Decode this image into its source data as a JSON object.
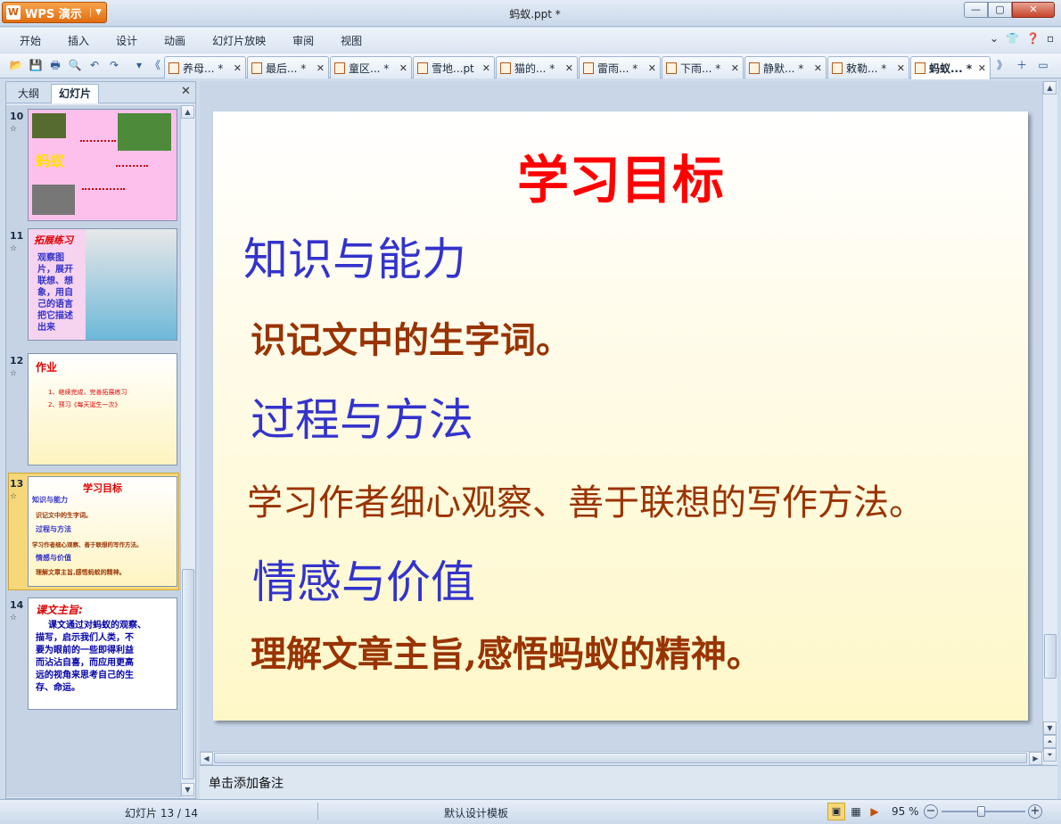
{
  "app": {
    "name": "WPS 演示",
    "doc_title": "蚂蚁.ppt *"
  },
  "window_controls": {
    "min": "—",
    "max": "▢",
    "close": "✕"
  },
  "menu": [
    "开始",
    "插入",
    "设计",
    "动画",
    "幻灯片放映",
    "审阅",
    "视图"
  ],
  "doc_tabs": [
    {
      "label": "养母... *"
    },
    {
      "label": "最后... *"
    },
    {
      "label": "童区... *"
    },
    {
      "label": "雪地...pt"
    },
    {
      "label": "猫的... *"
    },
    {
      "label": "雷雨... *"
    },
    {
      "label": "下雨... *"
    },
    {
      "label": "静默... *"
    },
    {
      "label": "敕勒... *"
    },
    {
      "label": "蚂蚁... *",
      "active": true
    }
  ],
  "pane": {
    "tab_outline": "大纲",
    "tab_slides": "幻灯片",
    "close": "✕"
  },
  "thumbnails": [
    {
      "num": "10",
      "star": "☆",
      "title": "蚂蚁"
    },
    {
      "num": "11",
      "star": "☆",
      "title": "拓展练习",
      "text": [
        "观察图",
        "片，展开",
        "联想、想",
        "象，用自",
        "己的语言",
        "把它描述",
        "出来"
      ]
    },
    {
      "num": "12",
      "star": "☆",
      "title": "作业",
      "lines": [
        "1、继续完成，完善拓展练习",
        "2、预习《每天诞生一次》"
      ]
    },
    {
      "num": "13",
      "star": "☆",
      "title": "学习目标",
      "lines": [
        "知识与能力",
        "识记文中的生字词。",
        "过程与方法",
        "学习作者细心观察、善于联想的写作方法。",
        "情感与价值",
        "理解文章主旨,感悟蚂蚁的精神。"
      ]
    },
    {
      "num": "14",
      "star": "☆",
      "title": "课文主旨:",
      "lines": [
        "课文通过对蚂蚁的观察、",
        "描写，启示我们人类，不",
        "要为眼前的一些即得利益",
        "而沾沾自喜，而应用更高",
        "远的视角来思考自己的生",
        "存、命运。"
      ]
    }
  ],
  "slide": {
    "title": "学习目标",
    "sections": [
      {
        "heading": "知识与能力",
        "body": "识记文中的生字词。"
      },
      {
        "heading": "过程与方法",
        "body": "学习作者细心观察、善于联想的写作方法。"
      },
      {
        "heading": "情感与价值",
        "body": "理解文章主旨,感悟蚂蚁的精神。"
      }
    ]
  },
  "notes_placeholder": "单击添加备注",
  "status": {
    "slide_pos": "幻灯片 13 / 14",
    "template": "默认设计模板",
    "zoom": "95 %"
  },
  "colors": {
    "slide_title": "#ff0000",
    "section_heading": "#3333cc",
    "section_body": "#993300",
    "wps_orange": "#e06d10"
  }
}
